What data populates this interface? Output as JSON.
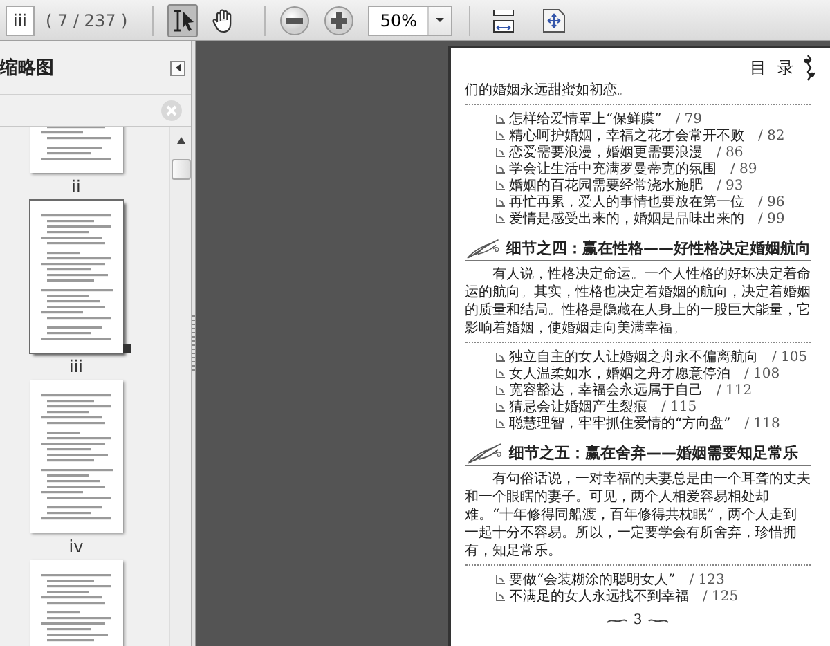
{
  "toolbar": {
    "page_field": {
      "value": "iii"
    },
    "page_count": "( 7 / 237 )",
    "tools": [
      {
        "kind": "select",
        "selected": true
      },
      {
        "kind": "hand",
        "selected": false
      }
    ],
    "zoom_field": {
      "value": "50%"
    }
  },
  "sidebar": {
    "title": "缩略图",
    "thumbnails": [
      {
        "label": "ii",
        "selected": false
      },
      {
        "label": "iii",
        "selected": true
      },
      {
        "label": "iv",
        "selected": false
      },
      {
        "selected": false
      }
    ]
  },
  "document": {
    "heading": "目 录",
    "blocks": [
      {
        "kind": "text",
        "text": "们的婚姻永远甜蜜如初恋。"
      },
      {
        "kind": "list",
        "items": [
          {
            "title": "怎样给爱情罩上“保鲜膜”",
            "page": "/ 79"
          },
          {
            "title": "精心呵护婚姻，幸福之花才会常开不败",
            "page": "/ 82"
          },
          {
            "title": "恋爱需要浪漫，婚姻更需要浪漫",
            "page": "/ 86"
          },
          {
            "title": "学会让生活中充满罗曼蒂克的氛围",
            "page": "/ 89"
          },
          {
            "title": "婚姻的百花园需要经常浇水施肥",
            "page": "/ 93"
          },
          {
            "title": "再忙再累，爱人的事情也要放在第一位",
            "page": "/ 96"
          },
          {
            "title": "爱情是感受出来的，婚姻是品味出来的",
            "page": "/ 99"
          }
        ]
      },
      {
        "kind": "heading",
        "text": "细节之四：赢在性格——好性格决定婚姻航向"
      },
      {
        "kind": "paragraph",
        "text": "有人说，性格决定命运。一个人性格的好坏决定着命运的航向。其实，性格也决定着婚姻的航向，决定着婚姻的质量和结局。性格是隐藏在人身上的一股巨大能量，它影响着婚姻，使婚姻走向美满幸福。"
      },
      {
        "kind": "list",
        "items": [
          {
            "title": "独立自主的女人让婚姻之舟永不偏离航向",
            "page": "/ 105"
          },
          {
            "title": "女人温柔如水，婚姻之舟才愿意停泊",
            "page": "/ 108"
          },
          {
            "title": "宽容豁达，幸福会永远属于自己",
            "page": "/ 112"
          },
          {
            "title": "猜忌会让婚姻产生裂痕",
            "page": "/ 115"
          },
          {
            "title": "聪慧理智，牢牢抓住爱情的“方向盘”",
            "page": "/ 118"
          }
        ]
      },
      {
        "kind": "heading",
        "text": "细节之五：赢在舍弃——婚姻需要知足常乐"
      },
      {
        "kind": "paragraph",
        "text": "有句俗话说，一对幸福的夫妻总是由一个耳聋的丈夫和一个眼瞎的妻子。可见，两个人相爱容易相处却难。“十年修得同船渡，百年修得共枕眠”，两个人走到一起十分不容易。所以，一定要学会有所舍弃，珍惜拥有，知足常乐。"
      },
      {
        "kind": "list",
        "items": [
          {
            "title": "要做“会装糊涂的聪明女人”",
            "page": "/ 123"
          },
          {
            "title": "不满足的女人永远找不到幸福",
            "page": "/ 125"
          }
        ]
      }
    ],
    "footer": "3"
  }
}
